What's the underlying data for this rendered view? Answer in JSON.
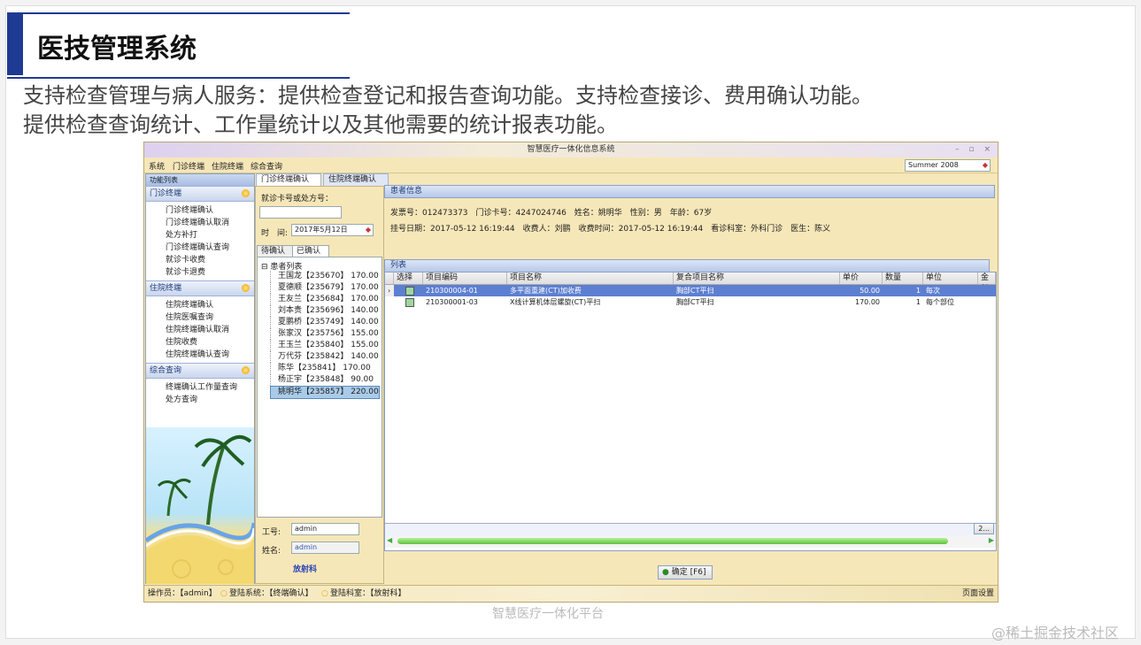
{
  "slide": {
    "title": "医技管理系统",
    "description_line1": "支持检查管理与病人服务：提供检查登记和报告查询功能。支持检查接诊、费用确认功能。",
    "description_line2": "提供检查查询统计、工作量统计以及其他需要的统计报表功能。",
    "footer": "智慧医疗一体化平台",
    "watermark": "@稀土掘金技术社区"
  },
  "app": {
    "window_title": "智慧医疗一体化信息系统",
    "menu": [
      "系统",
      "门诊终端",
      "住院终端",
      "综合查询"
    ],
    "theme": "Summer 2008",
    "sidebar": {
      "header": "功能列表",
      "groups": [
        {
          "label": "门诊终端",
          "items": [
            "门诊终端确认",
            "门诊终端确认取消",
            "处方补打",
            "门诊终端确认查询",
            "就诊卡收费",
            "就诊卡退费"
          ]
        },
        {
          "label": "住院终端",
          "items": [
            "住院终端确认",
            "住院医嘱查询",
            "住院终端确认取消",
            "住院收费",
            "住院终端确认查询"
          ]
        },
        {
          "label": "综合查询",
          "items": [
            "终端确认工作量查询",
            "处方查询"
          ]
        }
      ]
    },
    "tabs": [
      "门诊终端确认",
      "住院终端确认"
    ],
    "left_panel": {
      "card_label": "就诊卡号或处方号：",
      "card_value": "",
      "time_label": "时　间:",
      "time_value": "2017年5月12日",
      "subtabs": [
        "待确认",
        "已确认"
      ],
      "tree_root": "患者列表",
      "patients": [
        "王国龙【235670】 170.00",
        "夏德顺【235679】 170.00",
        "王友兰【235684】 170.00",
        "刘本贵【235696】 140.00",
        "夏鹏桥【235749】 140.00",
        "张家汉【235756】 155.00",
        "王玉兰【235840】 155.00",
        "万代芬【235842】 140.00",
        "陈华【235841】 170.00",
        "杨正宇【235848】 90.00",
        "姚明华【235857】 220.00"
      ],
      "worker_label": "工号:",
      "worker_value": "admin",
      "name_label": "姓名:",
      "name_value": "admin",
      "dept": "放射科"
    },
    "patient_info": {
      "header": "患者信息",
      "line1": "发票号：012473373　门诊卡号：4247024746　姓名：姚明华　性别：男　年龄：67岁",
      "line2": "挂号日期：2017-05-12 16:19:44　收费人：刘鹏　收费时间：2017-05-12 16:19:44　看诊科室：外科门诊　医生：陈义"
    },
    "list": {
      "header": "列表",
      "columns": [
        "选择",
        "项目编码",
        "项目名称",
        "复合项目名称",
        "单价",
        "数量",
        "单位",
        "金额"
      ],
      "rows": [
        {
          "code": "210300004-01",
          "name": "多平面重建(CT)加收费",
          "composite": "胸部CT平扫",
          "price": "50.00",
          "qty": "1",
          "unit": "每次"
        },
        {
          "code": "210300001-03",
          "name": "X线计算机体层螺旋(CT)平扫",
          "composite": "胸部CT平扫",
          "price": "170.00",
          "qty": "1",
          "unit": "每个部位"
        }
      ],
      "more_button": "2..."
    },
    "confirm_button": "确定 [F6]",
    "status": {
      "operator": "操作员：【admin】",
      "system": "登陆系统：【终端确认】",
      "dept": "登陆科室：【放射科】",
      "page_setup": "页面设置"
    }
  }
}
